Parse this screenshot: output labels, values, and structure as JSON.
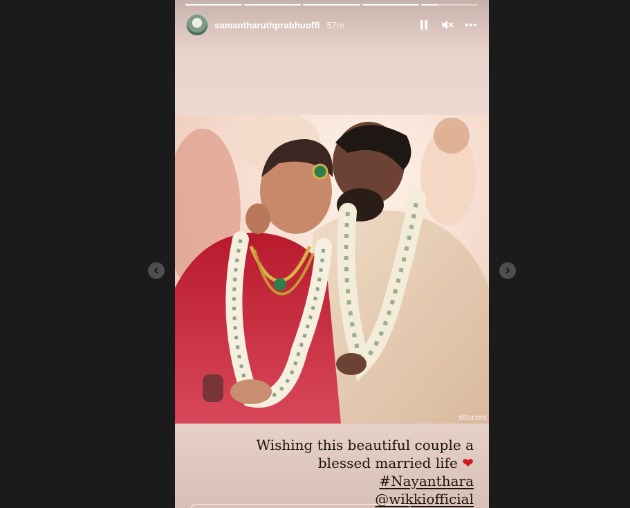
{
  "story": {
    "username": "samantharuthprabhuoffl",
    "timestamp": "57m",
    "progress_segments": [
      1,
      1,
      1,
      1,
      0.3
    ],
    "watermark": "stories",
    "caption_lines": [
      "Wishing this beautiful couple a",
      "blessed married life",
      "#Nayanthara",
      "@wikkiofficial"
    ],
    "heart_glyph": "❤"
  },
  "icons": {
    "avatar": "profile-avatar",
    "pause": "pause-icon",
    "mute": "muted-speaker-icon",
    "more": "more-options-icon",
    "prev": "chevron-left-icon",
    "next": "chevron-right-icon"
  },
  "colors": {
    "page_background": "#1b1b1b",
    "heart": "#d1161f",
    "nav_button": "#4e4e4e"
  }
}
